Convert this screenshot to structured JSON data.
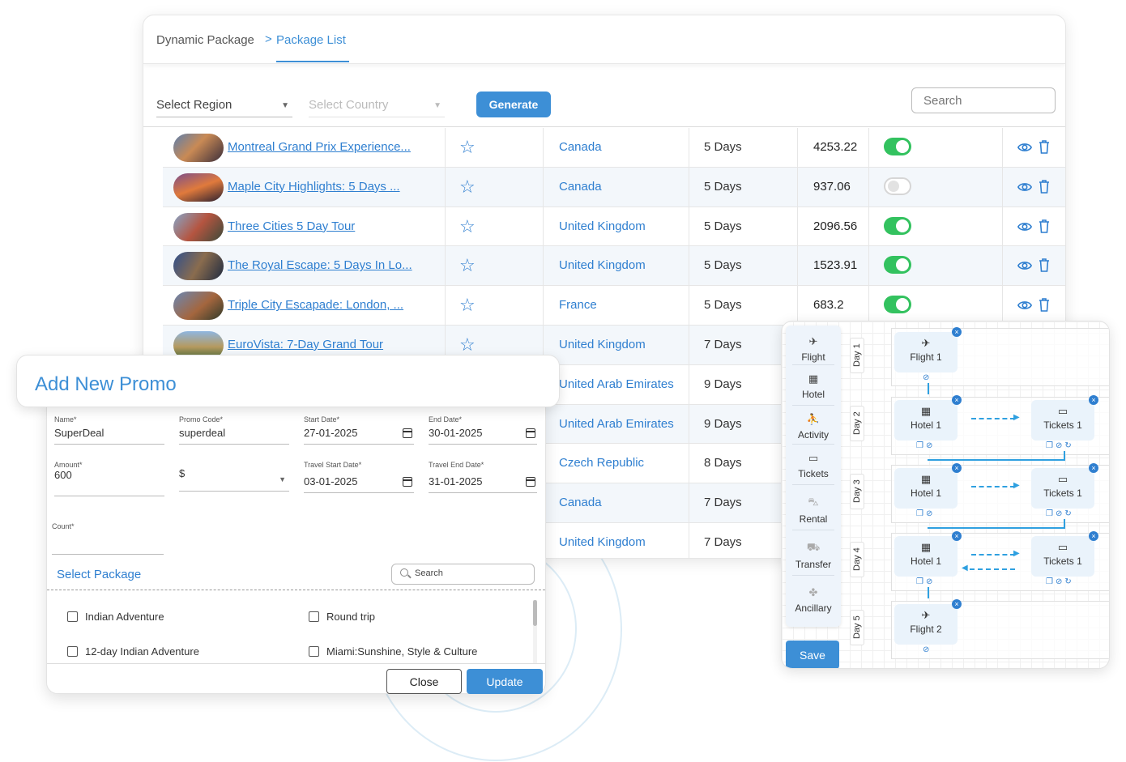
{
  "breadcrumb": {
    "root": "Dynamic Package",
    "separator": ">",
    "current": "Package List"
  },
  "filters": {
    "region_placeholder": "Select Region",
    "country_placeholder": "Select Country",
    "generate_label": "Generate",
    "search_placeholder": "Search"
  },
  "packages": [
    {
      "name": "Montreal Grand Prix Experience...",
      "country": "Canada",
      "days": "5 Days",
      "price": "4253.22",
      "active": true
    },
    {
      "name": "Maple City Highlights: 5 Days ...",
      "country": "Canada",
      "days": "5 Days",
      "price": "937.06",
      "active": false
    },
    {
      "name": "Three Cities 5 Day Tour",
      "country": "United Kingdom",
      "days": "5 Days",
      "price": "2096.56",
      "active": true
    },
    {
      "name": "The Royal Escape: 5 Days In Lo...",
      "country": "United Kingdom",
      "days": "5 Days",
      "price": "1523.91",
      "active": true
    },
    {
      "name": "Triple City Escapade: London, ...",
      "country": "France",
      "days": "5 Days",
      "price": "683.2",
      "active": true
    },
    {
      "name": "EuroVista: 7-Day Grand Tour",
      "country": "United Kingdom",
      "days": "7 Days",
      "price": "",
      "active": null
    },
    {
      "name": "",
      "country": "United Arab Emirates",
      "days": "9 Days",
      "price": "",
      "active": null
    },
    {
      "name": "",
      "country": "United Arab Emirates",
      "days": "9 Days",
      "price": "",
      "active": null
    },
    {
      "name": "",
      "country": "Czech Republic",
      "days": "8 Days",
      "price": "",
      "active": null
    },
    {
      "name": "",
      "country": "Canada",
      "days": "7 Days",
      "price": "",
      "active": null
    },
    {
      "name": "",
      "country": "United Kingdom",
      "days": "7 Days",
      "price": "",
      "active": null
    }
  ],
  "promo": {
    "title": "Add New Promo",
    "name_label": "Name*",
    "name_value": "SuperDeal",
    "code_label": "Promo Code*",
    "code_value": "superdeal",
    "start_label": "Start Date*",
    "start_value": "27-01-2025",
    "end_label": "End Date*",
    "end_value": "30-01-2025",
    "amount_label": "Amount*",
    "amount_value": "600",
    "currency_value": "$",
    "travel_start_label": "Travel Start Date*",
    "travel_start_value": "03-01-2025",
    "travel_end_label": "Travel End Date*",
    "travel_end_value": "31-01-2025",
    "count_label": "Count*",
    "select_package_label": "Select Package",
    "search_placeholder": "Search",
    "options": [
      "Indian Adventure",
      "Round trip",
      "12-day Indian Adventure",
      "Miami:Sunshine, Style & Culture"
    ],
    "close_label": "Close",
    "update_label": "Update"
  },
  "itinerary": {
    "palette": [
      "Flight",
      "Hotel",
      "Activity",
      "Tickets",
      "Rental",
      "Transfer",
      "Ancillary"
    ],
    "save_label": "Save",
    "days": [
      "Day 1",
      "Day 2",
      "Day 3",
      "Day 4",
      "Day 5"
    ],
    "nodes": {
      "day1": [
        "Flight 1"
      ],
      "day2": [
        "Hotel 1",
        "Tickets 1"
      ],
      "day3": [
        "Hotel 1",
        "Tickets 1"
      ],
      "day4": [
        "Hotel 1",
        "Tickets 1"
      ],
      "day5": [
        "Flight 2"
      ]
    },
    "accent": "#2f7fd0"
  },
  "colors": {
    "primary": "#3d8fd6",
    "toggle_on": "#33c25f",
    "link": "#2f7fd0"
  }
}
